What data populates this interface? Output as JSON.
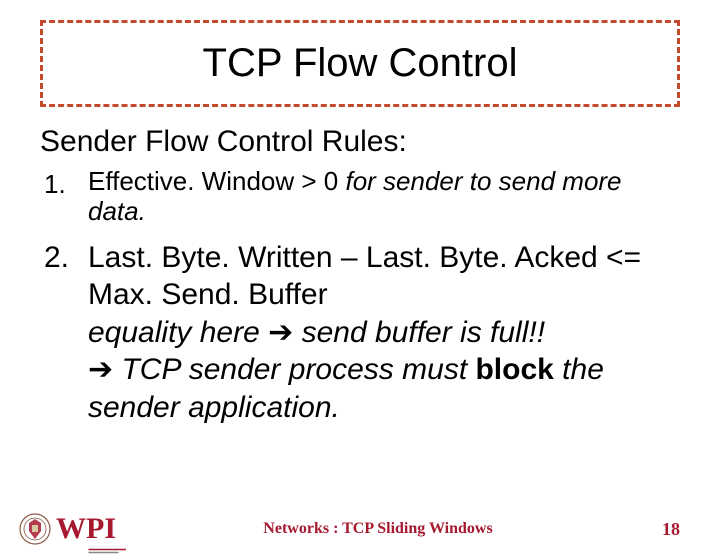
{
  "title": "TCP Flow Control",
  "subtitle": "Sender Flow Control Rules:",
  "items": [
    {
      "marker": "1.",
      "plain_a": "Effective. Window > 0 ",
      "italic_a": " for sender to send more data."
    },
    {
      "marker": "2.",
      "line1": "Last. Byte. Written – Last. Byte. Acked <= Max. Send. Buffer",
      "line2_a": "equality here ",
      "arrow1": "➔",
      "line2_b": " send buffer is full!!",
      "arrow2": "➔",
      "line3_a": " TCP sender process must ",
      "bold": "block",
      "line3_b": " the sender application."
    }
  ],
  "footer": {
    "logo_text": "WPI",
    "center": "Networks : TCP Sliding Windows",
    "page": "18"
  }
}
